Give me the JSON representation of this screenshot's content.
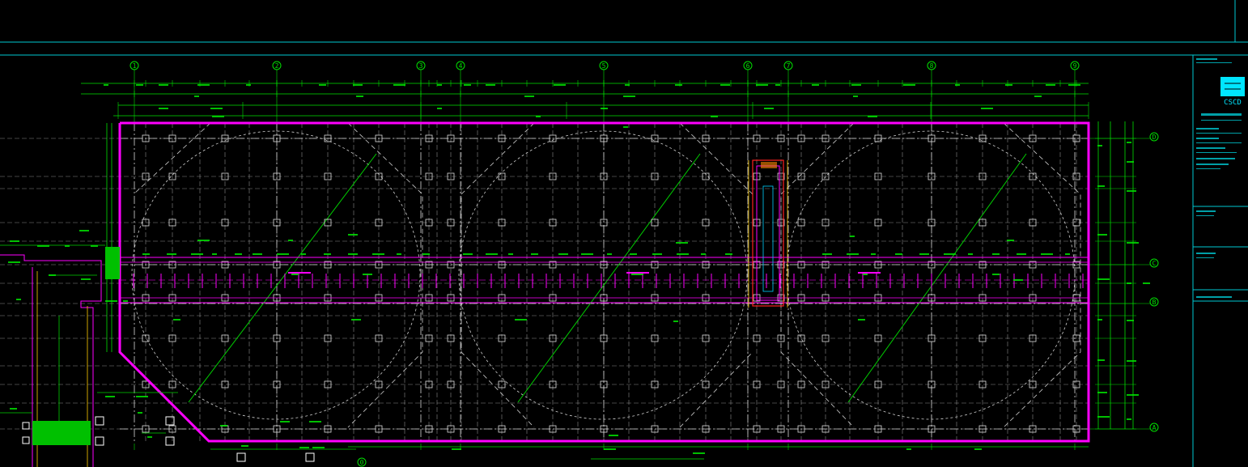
{
  "axes_top": [
    "1",
    "2",
    "3",
    "4",
    "5",
    "6",
    "7",
    "8",
    "9"
  ],
  "axes_right": [
    "D",
    "C",
    "B",
    "A"
  ],
  "axis_bottom_left": "0",
  "title_block": {
    "logo_text": "CSCD"
  },
  "colors": {
    "background": "#000000",
    "frame": "#00c8d2",
    "grid": "#ffffff",
    "dims": "#00e000",
    "wall": "#ff00ff",
    "logo": "#00e5ff"
  }
}
